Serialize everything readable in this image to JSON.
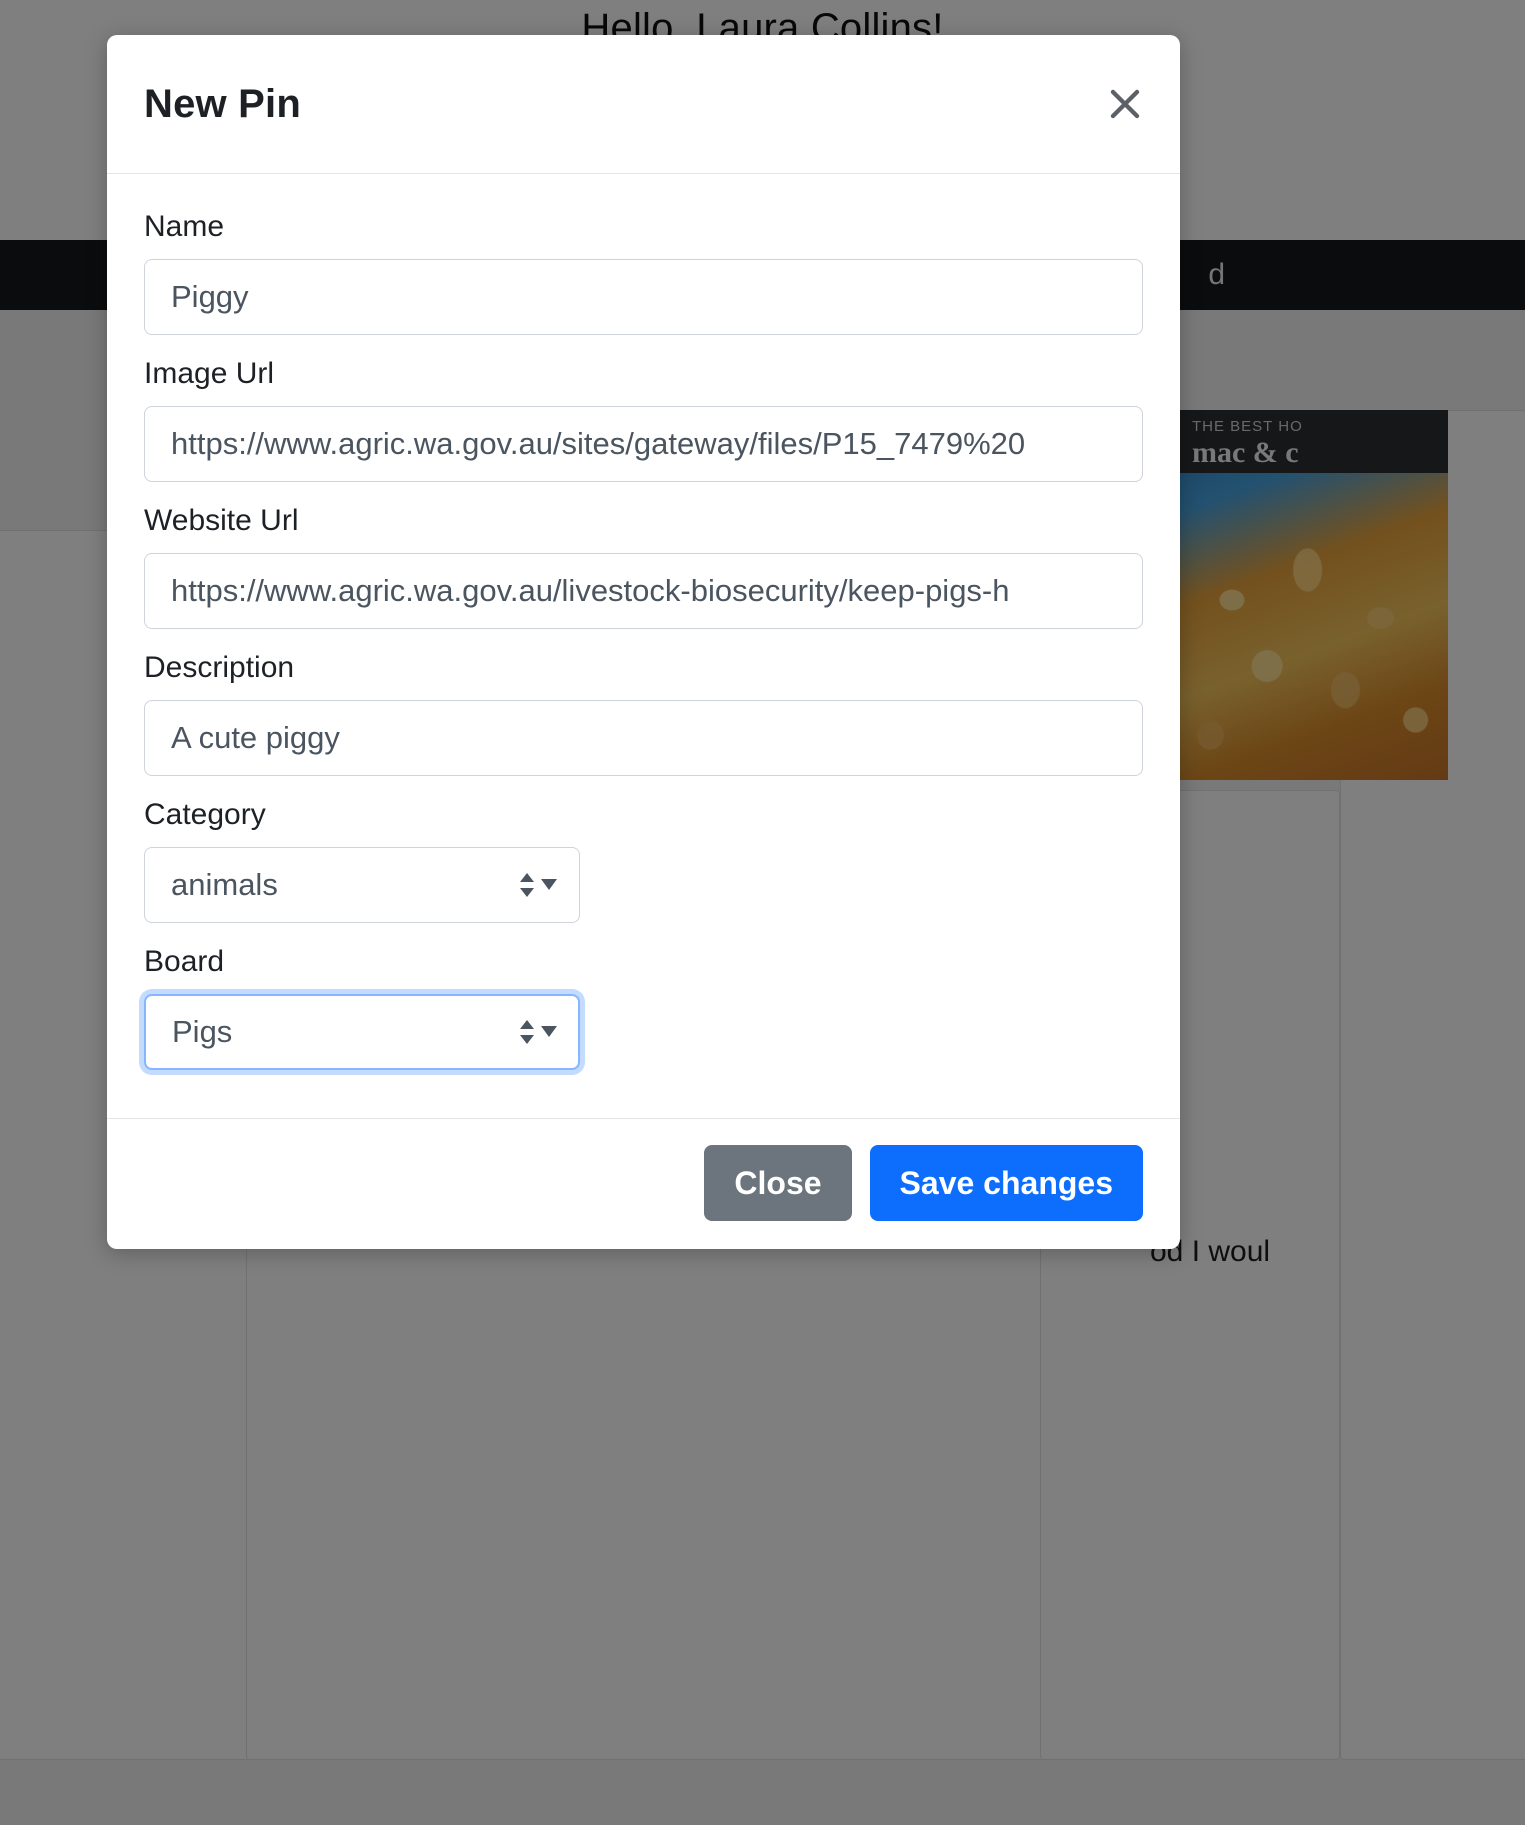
{
  "background": {
    "greeting": "Hello, Laura Collins!",
    "navbar_text": "d",
    "photo": {
      "kicker": "THE BEST HO",
      "title": "mac & c"
    },
    "snippet": "od I woul"
  },
  "modal": {
    "title": "New Pin",
    "close_icon": "close-icon",
    "fields": [
      {
        "label": "Name",
        "value": "Piggy",
        "type": "text",
        "name": "name"
      },
      {
        "label": "Image Url",
        "value": "https://www.agric.wa.gov.au/sites/gateway/files/P15_7479%20",
        "type": "text",
        "name": "image-url"
      },
      {
        "label": "Website Url",
        "value": "https://www.agric.wa.gov.au/livestock-biosecurity/keep-pigs-h",
        "type": "text",
        "name": "website-url"
      },
      {
        "label": "Description",
        "value": "A cute piggy",
        "type": "text",
        "name": "description"
      },
      {
        "label": "Category",
        "value": "animals",
        "type": "select",
        "name": "category",
        "focused": false
      },
      {
        "label": "Board",
        "value": "Pigs",
        "type": "select",
        "name": "board",
        "focused": true
      }
    ],
    "buttons": {
      "close": "Close",
      "save": "Save changes"
    }
  },
  "colors": {
    "primary": "#0d6efd",
    "secondary": "#6c757d",
    "focus_ring": "#86b7fe",
    "border": "#ced4da",
    "text": "#1d2125",
    "input_text": "#4a5560"
  }
}
